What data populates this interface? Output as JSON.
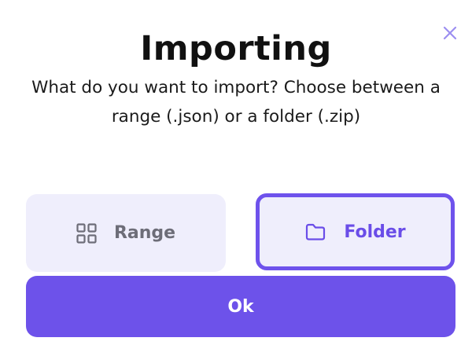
{
  "dialog": {
    "title": "Importing",
    "description": "What do you want to import? Choose between a range (.json) or a folder (.zip)",
    "close_icon": "close-icon",
    "options": [
      {
        "label": "Range",
        "icon": "grid-icon",
        "selected": false
      },
      {
        "label": "Folder",
        "icon": "folder-icon",
        "selected": true
      }
    ],
    "ok_label": "Ok"
  },
  "colors": {
    "accent": "#6d52ea",
    "option_background": "#efeefc",
    "close_icon": "#9c8ff0",
    "muted_text": "#6d6d78"
  }
}
